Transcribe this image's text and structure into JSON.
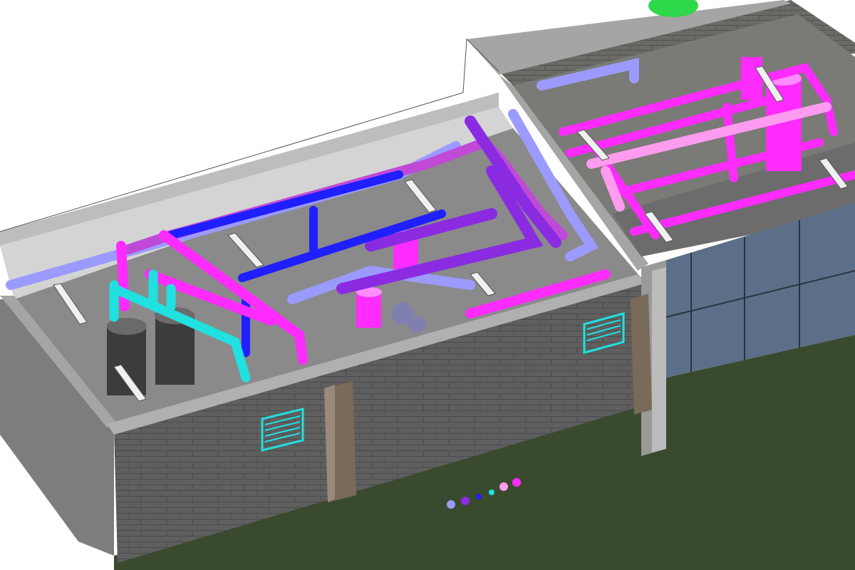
{
  "view": {
    "type": "3d-isometric-mep-model",
    "background": "#ffffff"
  },
  "building": {
    "wall_color": "#5f5f5f",
    "wall_top_color": "#9a9a9a",
    "brick_line_color": "#4a4a4a",
    "floor_color": "#8a8a8a",
    "ground_color": "#3a4a2e",
    "curtain_wall_color": "#5b6f88",
    "column_color": "#7a6a5a"
  },
  "systems": [
    {
      "name": "chilled-water-supply",
      "color": "#ff2bff"
    },
    {
      "name": "chilled-water-return",
      "color": "#c04ad8"
    },
    {
      "name": "hot-water-supply",
      "color": "#8a2be2"
    },
    {
      "name": "hot-water-return",
      "color": "#9b9bff"
    },
    {
      "name": "domestic-water",
      "color": "#1f1fff"
    },
    {
      "name": "condenser-water",
      "color": "#20e0e0"
    },
    {
      "name": "light-pink",
      "color": "#ff9cf0"
    }
  ],
  "equipment": [
    {
      "name": "boiler-left",
      "color": "#3c3c3c"
    },
    {
      "name": "boiler-right",
      "color": "#3c3c3c"
    },
    {
      "name": "pump",
      "color": "#8080b0"
    },
    {
      "name": "expansion-tank",
      "color": "#ff2bff"
    },
    {
      "name": "rooftop-unit",
      "color": "#2ed84a"
    }
  ],
  "louvers": {
    "color": "#20e0e0"
  },
  "light_fixtures": {
    "color": "#f0f0f0"
  },
  "legend_dots": [
    "#9b9bff",
    "#8a2be2",
    "#1f1fff",
    "#20e0e0",
    "#ff9cf0",
    "#ff2bff"
  ]
}
